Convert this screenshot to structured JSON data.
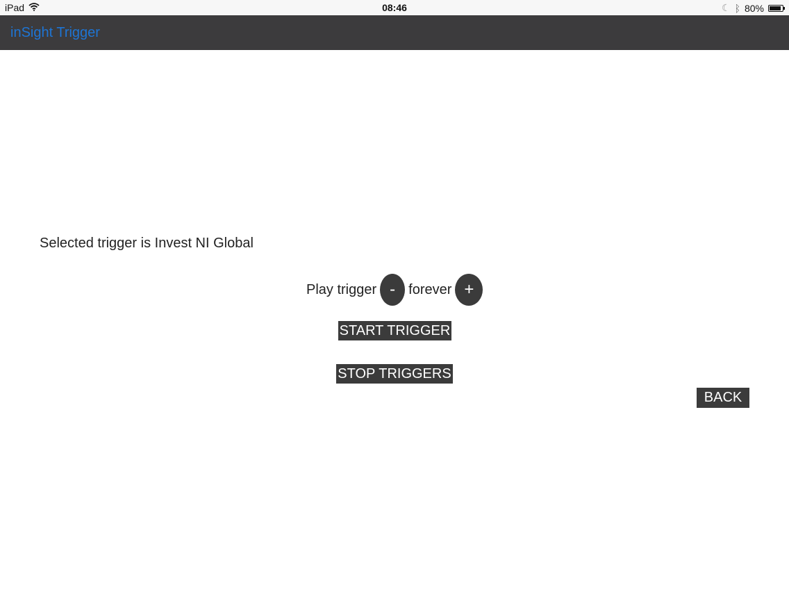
{
  "status_bar": {
    "device": "iPad",
    "time": "08:46",
    "battery": "80%",
    "icons": [
      "wifi-icon",
      "moon-icon",
      "bluetooth-icon",
      "battery-icon"
    ]
  },
  "header": {
    "title": "inSight Trigger",
    "title_color": "#1e75d5",
    "background": "#3c3b3d"
  },
  "main": {
    "selected_text": "Selected trigger is Invest NI Global",
    "play_label": "Play trigger",
    "minus_label": "-",
    "duration": "forever",
    "plus_label": "+",
    "start_label": "START TRIGGER",
    "stop_label": "STOP TRIGGERS",
    "back_label": "BACK"
  }
}
